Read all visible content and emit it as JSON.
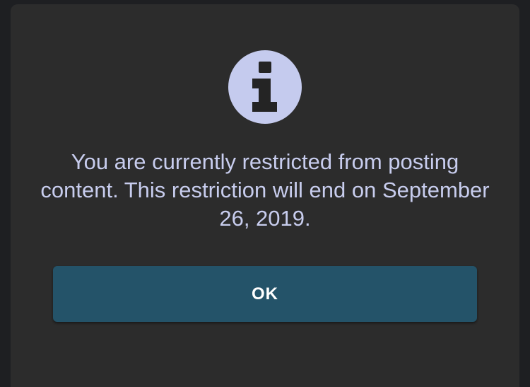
{
  "dialog": {
    "icon": "info-icon",
    "message": "You are currently restricted from posting content. This restriction will end on September 26, 2019.",
    "ok_label": "OK"
  },
  "colors": {
    "background": "#1e1f22",
    "dialog": "#2c2c2c",
    "icon": "#c5cbee",
    "text": "#c8cdee",
    "button": "#245369",
    "button_text": "#ffffff"
  }
}
